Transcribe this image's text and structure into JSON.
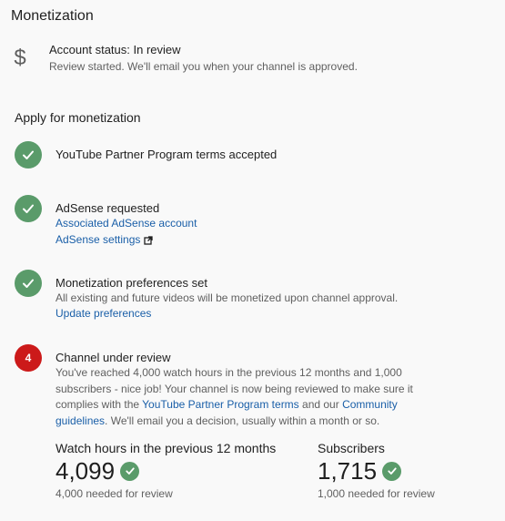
{
  "page": {
    "title": "Monetization"
  },
  "account_status": {
    "icon": "dollar-icon",
    "title": "Account status: In review",
    "subtitle": "Review started. We'll email you when your channel is approved."
  },
  "apply": {
    "heading": "Apply for monetization",
    "steps": [
      {
        "state": "done",
        "title": "YouTube Partner Program terms accepted"
      },
      {
        "state": "done",
        "title": "AdSense requested",
        "links": [
          "Associated AdSense account",
          "AdSense settings"
        ]
      },
      {
        "state": "done",
        "title": "Monetization preferences set",
        "description": "All existing and future videos will be monetized upon channel approval.",
        "link": "Update preferences"
      },
      {
        "state": "current",
        "number": "4",
        "title": "Channel under review",
        "description_part1": "You've reached 4,000 watch hours in the previous 12 months and 1,000 subscribers - nice job! Your channel is now being reviewed to make sure it complies with the ",
        "link_terms": "YouTube Partner Program terms",
        "description_part2": " and our ",
        "link_guidelines": "Community guidelines",
        "description_part3": ". We'll email you a decision, usually within a month or so."
      }
    ]
  },
  "metrics": {
    "watch_hours": {
      "label": "Watch hours in the previous 12 months",
      "value": "4,099",
      "note": "4,000 needed for review"
    },
    "subscribers": {
      "label": "Subscribers",
      "value": "1,715",
      "note": "1,000 needed for review"
    }
  },
  "colors": {
    "check_green": "#5a9b6a",
    "step_red": "#cc1a1a",
    "link_blue": "#1a5fa8"
  }
}
